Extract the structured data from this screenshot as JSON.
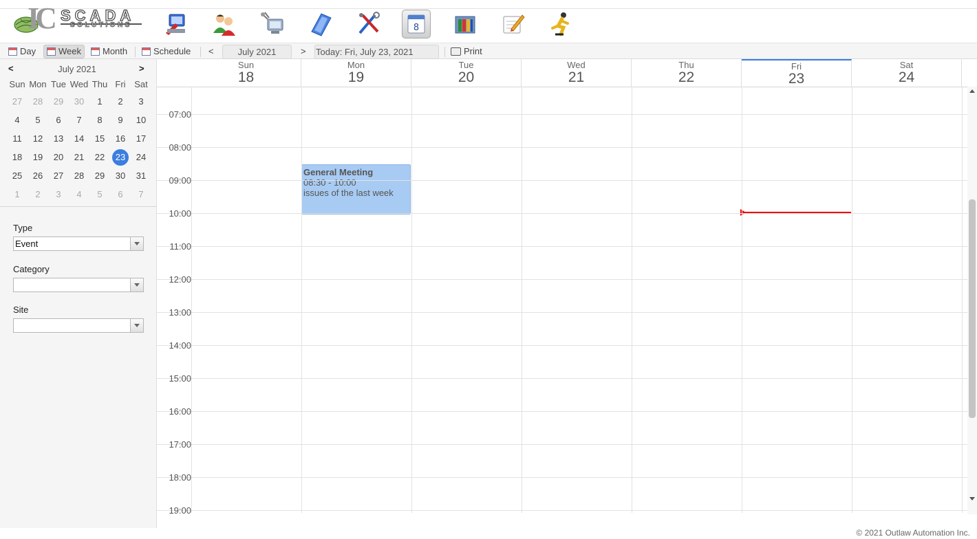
{
  "app": {
    "logo_main": "IC",
    "logo_word": "SCADA",
    "logo_sub": "SOLUTIONS"
  },
  "nav_icons": [
    {
      "name": "operator-station-icon"
    },
    {
      "name": "users-icon"
    },
    {
      "name": "network-icon"
    },
    {
      "name": "documents-icon"
    },
    {
      "name": "tools-icon"
    },
    {
      "name": "calendar-icon"
    },
    {
      "name": "library-icon"
    },
    {
      "name": "notes-icon"
    },
    {
      "name": "runner-icon"
    }
  ],
  "toolbar": {
    "day": "Day",
    "week": "Week",
    "month": "Month",
    "schedule": "Schedule",
    "prev": "<",
    "period": "July 2021",
    "next": ">",
    "today": "Today: Fri, July 23, 2021",
    "print": "Print"
  },
  "mini_calendar": {
    "prev": "<",
    "next": ">",
    "title": "July 2021",
    "weekdays": [
      "Sun",
      "Mon",
      "Tue",
      "Wed",
      "Thu",
      "Fri",
      "Sat"
    ],
    "weeks": [
      [
        "27",
        "28",
        "29",
        "30",
        "1",
        "2",
        "3"
      ],
      [
        "4",
        "5",
        "6",
        "7",
        "8",
        "9",
        "10"
      ],
      [
        "11",
        "12",
        "13",
        "14",
        "15",
        "16",
        "17"
      ],
      [
        "18",
        "19",
        "20",
        "21",
        "22",
        "23",
        "24"
      ],
      [
        "25",
        "26",
        "27",
        "28",
        "29",
        "30",
        "31"
      ],
      [
        "1",
        "2",
        "3",
        "4",
        "5",
        "6",
        "7"
      ]
    ]
  },
  "filters": {
    "type_label": "Type",
    "type_value": "Event",
    "category_label": "Category",
    "category_value": "",
    "site_label": "Site",
    "site_value": ""
  },
  "week": {
    "days": [
      {
        "name": "Sun",
        "num": "18"
      },
      {
        "name": "Mon",
        "num": "19"
      },
      {
        "name": "Tue",
        "num": "20"
      },
      {
        "name": "Wed",
        "num": "21"
      },
      {
        "name": "Thu",
        "num": "22"
      },
      {
        "name": "Fri",
        "num": "23"
      },
      {
        "name": "Sat",
        "num": "24"
      }
    ],
    "hours": [
      "07:00",
      "08:00",
      "09:00",
      "10:00",
      "11:00",
      "12:00",
      "13:00",
      "14:00",
      "15:00",
      "16:00",
      "17:00",
      "18:00",
      "19:00"
    ]
  },
  "event": {
    "title": "General Meeting",
    "time": "08:30 - 10:00",
    "description": "issues of the last week"
  },
  "footer": "© 2021 Outlaw Automation Inc."
}
